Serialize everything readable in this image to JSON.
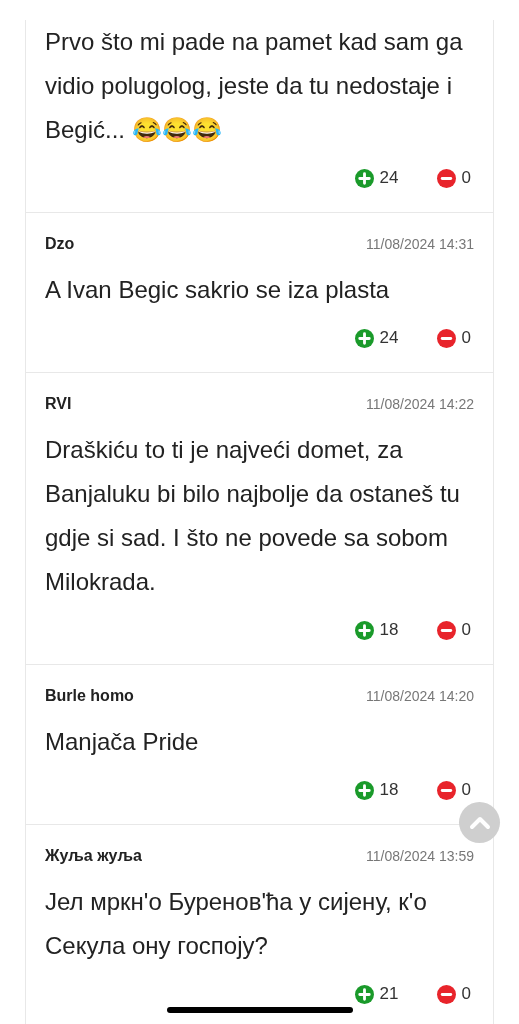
{
  "comments": [
    {
      "text": "Prvo što mi pade na pamet kad sam ga vidio polugolog, jeste da tu nedostaje i Begić... 😂😂😂",
      "upvotes": "24",
      "downvotes": "0"
    },
    {
      "author": "Dzo",
      "date": "11/08/2024 14:31",
      "text": "A Ivan Begic sakrio se iza plasta",
      "upvotes": "24",
      "downvotes": "0"
    },
    {
      "author": "RVI",
      "date": "11/08/2024 14:22",
      "text": "Draškiću to ti je najveći domet, za Banjaluku bi bilo najbolje da ostaneš tu gdje si sad. I što ne povede sa sobom Milokrada.",
      "upvotes": "18",
      "downvotes": "0"
    },
    {
      "author": "Burle homo",
      "date": "11/08/2024 14:20",
      "text": "Manjača Pride",
      "upvotes": "18",
      "downvotes": "0"
    },
    {
      "author": "Жуља жуља",
      "date": "11/08/2024 13:59",
      "text": "Јел мркн'о Буренов'ћа у сијену, к'о Секула ону госпоју?",
      "upvotes": "21",
      "downvotes": "0"
    }
  ]
}
